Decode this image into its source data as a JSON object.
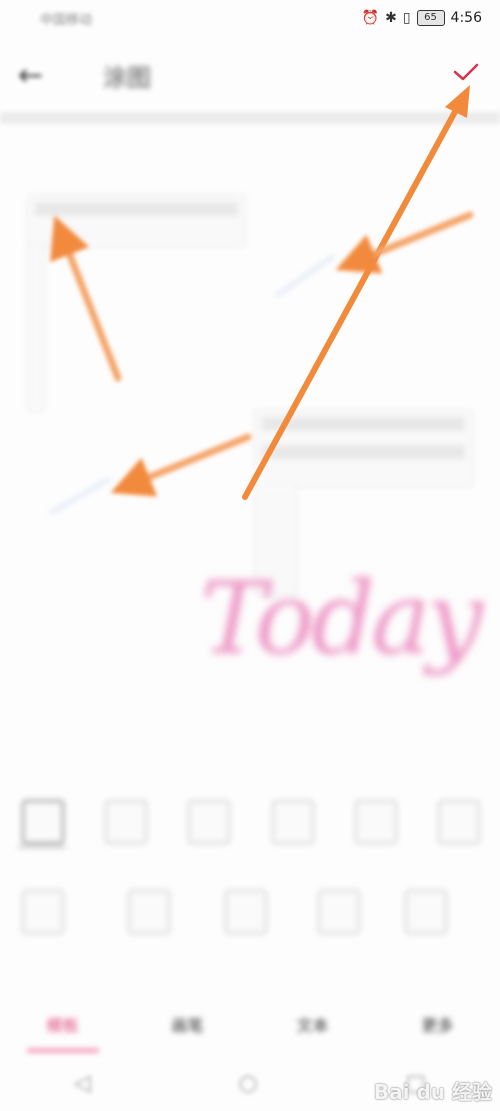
{
  "status_bar": {
    "carrier": "中国移动",
    "time": "4:56",
    "battery": "65",
    "alarm_icon": "alarm-icon",
    "bluetooth_icon": "bluetooth-icon",
    "vibrate_icon": "vibrate-icon"
  },
  "header": {
    "back_icon": "arrow-left-icon",
    "title": "涂图",
    "confirm_icon": "check-icon"
  },
  "canvas": {
    "handwriting": "Today"
  },
  "tabs": [
    {
      "label": "模板",
      "active": true
    },
    {
      "label": "画笔",
      "active": false
    },
    {
      "label": "文本",
      "active": false
    },
    {
      "label": "更多",
      "active": false
    }
  ],
  "nav": {
    "back_icon": "nav-back-icon",
    "home_icon": "nav-home-icon",
    "recents_icon": "nav-recents-icon"
  },
  "watermark": "Bai du 经验",
  "colors": {
    "accent": "#e0467b",
    "confirm": "#d9334d",
    "arrow": "#f28a3c",
    "handwriting": "#ee9ac7"
  }
}
